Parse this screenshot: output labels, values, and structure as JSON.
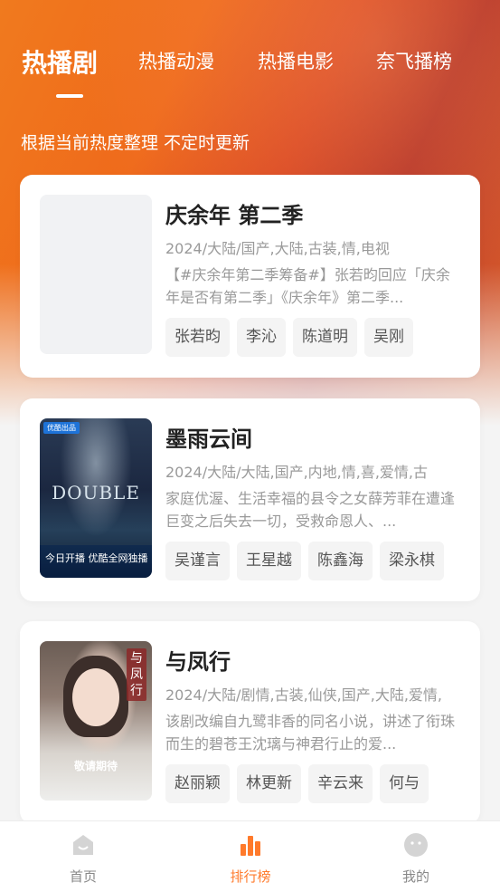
{
  "tabs": [
    {
      "label": "热播剧",
      "active": true
    },
    {
      "label": "热播动漫",
      "active": false
    },
    {
      "label": "热播电影",
      "active": false
    },
    {
      "label": "奈飞播榜",
      "active": false
    }
  ],
  "subtitle": "根据当前热度整理 不定时更新",
  "cards": [
    {
      "title": "庆余年 第二季",
      "meta": "2024/大陆/国产,大陆,古装,情,电视",
      "desc": "【#庆余年第二季筹备#】张若昀回应「庆余年是否有第二季」《庆余年》第二季...",
      "actors": [
        "张若昀",
        "李沁",
        "陈道明",
        "吴刚"
      ]
    },
    {
      "title": "墨雨云间",
      "meta": "2024/大陆/大陆,国产,内地,情,喜,爱情,古",
      "desc": "家庭优渥、生活幸福的县令之女薛芳菲在遭逢巨变之后失去一切，受救命恩人、...",
      "actors": [
        "吴谨言",
        "王星越",
        "陈鑫海",
        "梁永棋"
      ],
      "poster": {
        "badge": "优酷出品",
        "big_text": "DOUBLE",
        "bottom": "今日开播 优酷全网独播"
      }
    },
    {
      "title": "与凤行",
      "meta": "2024/大陆/剧情,古装,仙侠,国产,大陆,爱情,",
      "desc": "该剧改编自九鹭非香的同名小说，讲述了衔珠而生的碧苍王沈璃与神君行止的爱...",
      "actors": [
        "赵丽颖",
        "林更新",
        "辛云来",
        "何与"
      ],
      "poster": {
        "vertical_title": "与凤行",
        "bottom": "敬请期待"
      }
    }
  ],
  "nav": [
    {
      "label": "首页",
      "icon": "home-icon",
      "active": false
    },
    {
      "label": "排行榜",
      "icon": "ranking-bars-icon",
      "active": true
    },
    {
      "label": "我的",
      "icon": "profile-face-icon",
      "active": false
    }
  ],
  "colors": {
    "accent": "#ff7a2b",
    "hero_orange": "#ef6a1b",
    "hero_red": "#b02a22"
  }
}
